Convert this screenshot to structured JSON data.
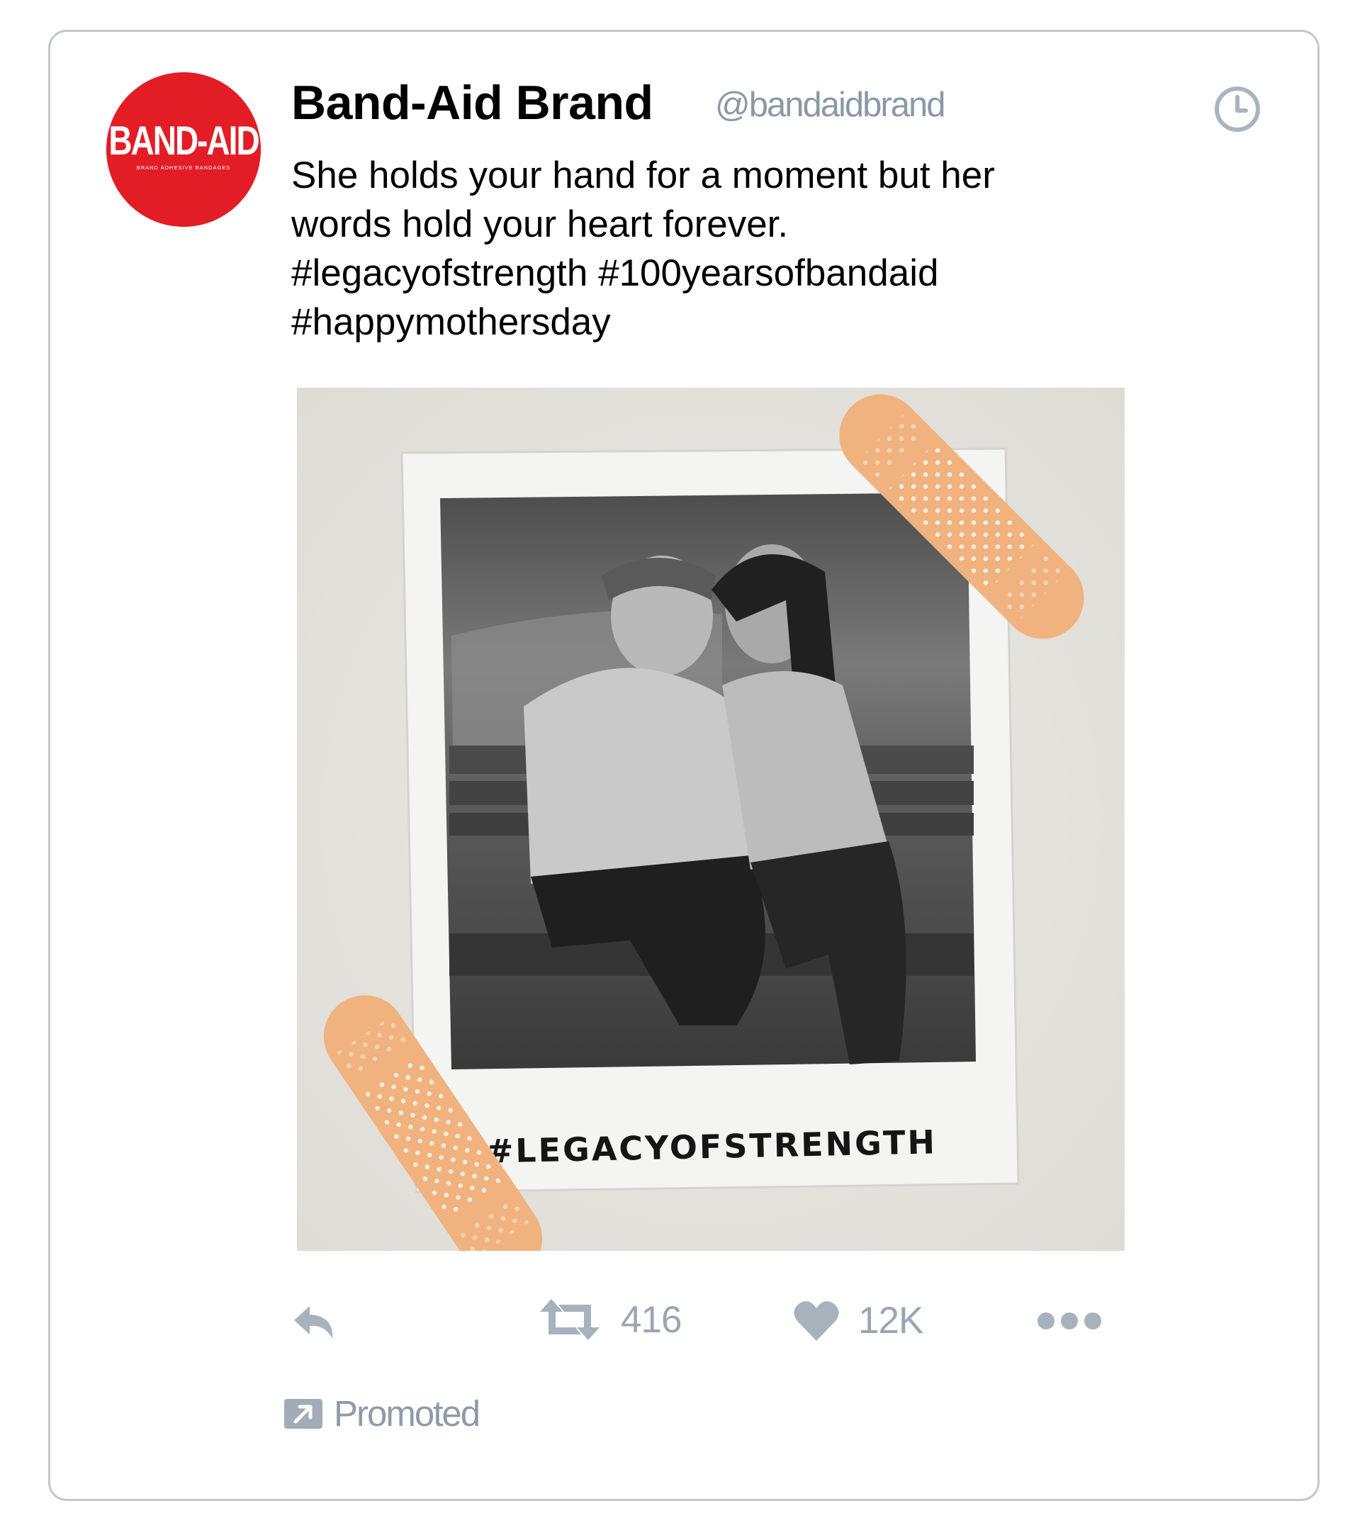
{
  "brand": {
    "logo_text": "BAND-AID",
    "logo_subtext": "BRAND ADHESIVE BANDAGES",
    "logo_color": "#e31d25"
  },
  "author": {
    "name": "Band-Aid Brand",
    "handle": "@bandaidbrand"
  },
  "tweet": {
    "lines": [
      "She holds your hand for a moment but her",
      "words hold your heart forever.",
      "#legacyofstrength #100yearsofbandaid",
      "#happymothersday"
    ]
  },
  "media": {
    "polaroid_caption": "#LEGACYOFSTRENGTH",
    "bandage_color": "#f0b27e"
  },
  "actions": {
    "reply_icon": "reply-icon",
    "retweet_icon": "retweet-icon",
    "retweet_count": "416",
    "like_icon": "heart-icon",
    "like_count": "12K",
    "more_icon": "more-dots-icon",
    "icon_color": "#a7b2bd"
  },
  "promoted": {
    "label": "Promoted",
    "icon": "promoted-arrow-icon"
  },
  "header": {
    "clock_icon": "clock-icon"
  }
}
